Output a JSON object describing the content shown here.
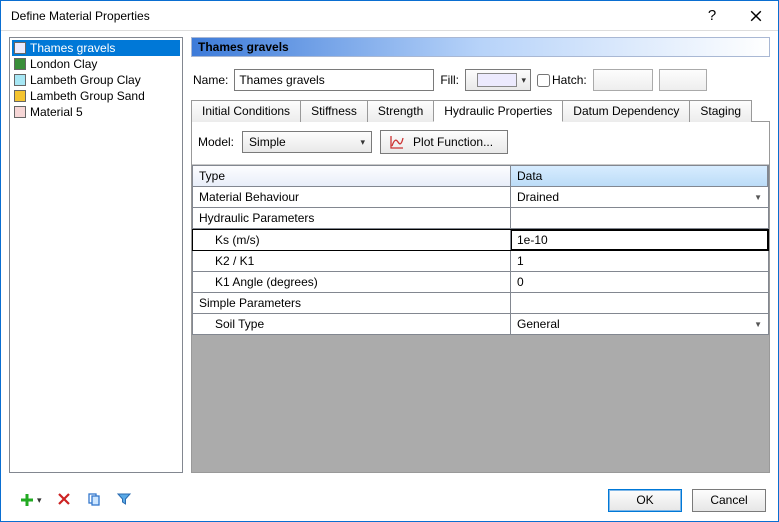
{
  "window": {
    "title": "Define Material Properties"
  },
  "materials": [
    {
      "name": "Thames gravels",
      "color": "#eceafd",
      "selected": true
    },
    {
      "name": "London Clay",
      "color": "#3a8f3a",
      "selected": false
    },
    {
      "name": "Lambeth Group Clay",
      "color": "#a7e7f4",
      "selected": false
    },
    {
      "name": "Lambeth Group Sand",
      "color": "#f4c430",
      "selected": false
    },
    {
      "name": "Material 5",
      "color": "#f6d6d6",
      "selected": false
    }
  ],
  "header": {
    "title": "Thames gravels"
  },
  "nameRow": {
    "label": "Name:",
    "value": "Thames gravels",
    "fillLabel": "Fill:",
    "hatchLabel": "Hatch:"
  },
  "tabs": {
    "items": [
      "Initial Conditions",
      "Stiffness",
      "Strength",
      "Hydraulic Properties",
      "Datum Dependency",
      "Staging"
    ],
    "activeIndex": 3
  },
  "modelRow": {
    "label": "Model:",
    "value": "Simple",
    "plotBtn": "Plot Function..."
  },
  "grid": {
    "headers": {
      "type": "Type",
      "data": "Data"
    },
    "rows": [
      {
        "kind": "prop",
        "label": "Material Behaviour",
        "value": "Drained",
        "dropdown": true
      },
      {
        "kind": "section",
        "label": "Hydraulic Parameters",
        "value": ""
      },
      {
        "kind": "sub",
        "label": "Ks (m/s)",
        "value": "1e-10",
        "focused": true
      },
      {
        "kind": "sub",
        "label": "K2 / K1",
        "value": "1"
      },
      {
        "kind": "sub",
        "label": "K1 Angle (degrees)",
        "value": "0"
      },
      {
        "kind": "section",
        "label": "Simple Parameters",
        "value": ""
      },
      {
        "kind": "sub",
        "label": "Soil Type",
        "value": "General",
        "dropdown": true
      }
    ]
  },
  "footer": {
    "ok": "OK",
    "cancel": "Cancel"
  }
}
